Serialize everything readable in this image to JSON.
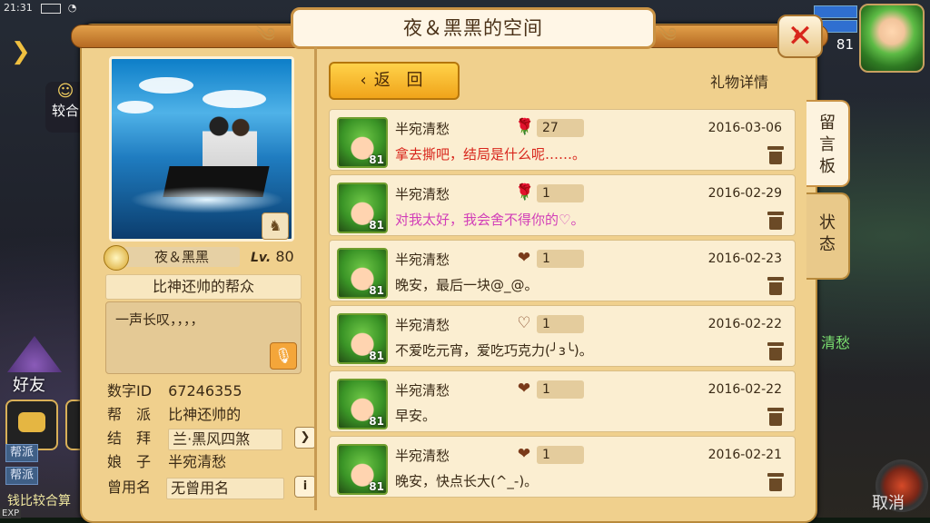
{
  "status_bar": {
    "time": "21:31"
  },
  "left_hud": {
    "chip_label": "较合",
    "friends_label": "好友",
    "gang_tags": [
      "帮派",
      "帮派"
    ],
    "gang_line": "钱比较合算",
    "exp_label": "EXP"
  },
  "right_hud": {
    "level": "81",
    "side_name": "清愁",
    "watermark": "取消"
  },
  "dialog": {
    "title": "夜＆黑黑的空间",
    "close_icon": "close-icon"
  },
  "profile": {
    "name": "夜＆黑黑",
    "level_prefix": "Lv.",
    "level": "80",
    "guild_title": "比神还帅的帮众",
    "signature": "一声长叹，，，，",
    "info": [
      {
        "key": "数字ID",
        "value": "67246355"
      },
      {
        "key": "帮　派",
        "value": "比神还帅的"
      },
      {
        "key": "结　拜",
        "value": "兰·黑风四煞"
      },
      {
        "key": "娘　子",
        "value": "半宛清愁"
      },
      {
        "key": "曾用名",
        "value": "无曾用名"
      }
    ]
  },
  "toolbar": {
    "back_label": "返 回",
    "gift_detail_label": "礼物详情"
  },
  "tabs": [
    {
      "label": "留言板",
      "active": true
    },
    {
      "label": "状态",
      "active": false
    }
  ],
  "messages": [
    {
      "sender": "半宛清愁",
      "level": "81",
      "gift_icon": "rose-icon",
      "gift_count": "27",
      "date": "2016-03-06",
      "text": "拿去撕吧，结局是什么呢……。",
      "text_color": "#d8261c"
    },
    {
      "sender": "半宛清愁",
      "level": "81",
      "gift_icon": "rose-icon",
      "gift_count": "1",
      "date": "2016-02-29",
      "text": "对我太好，我会舍不得你的♡。",
      "text_color": "#d23fb8"
    },
    {
      "sender": "半宛清愁",
      "level": "81",
      "gift_icon": "chocolate-heart-icon",
      "gift_count": "1",
      "date": "2016-02-23",
      "text": "晚安，最后一块@_@。",
      "text_color": "#3a2a16"
    },
    {
      "sender": "半宛清愁",
      "level": "81",
      "gift_icon": "heart-icon",
      "gift_count": "1",
      "date": "2016-02-22",
      "text": "不爱吃元宵，爱吃巧克力(╯з╰)。",
      "text_color": "#3a2a16"
    },
    {
      "sender": "半宛清愁",
      "level": "81",
      "gift_icon": "chocolate-heart-icon",
      "gift_count": "1",
      "date": "2016-02-22",
      "text": "早安。",
      "text_color": "#3a2a16"
    },
    {
      "sender": "半宛清愁",
      "level": "81",
      "gift_icon": "chocolate-heart-icon",
      "gift_count": "1",
      "date": "2016-02-21",
      "text": "晚安，快点长大(^_-)。",
      "text_color": "#3a2a16"
    }
  ]
}
